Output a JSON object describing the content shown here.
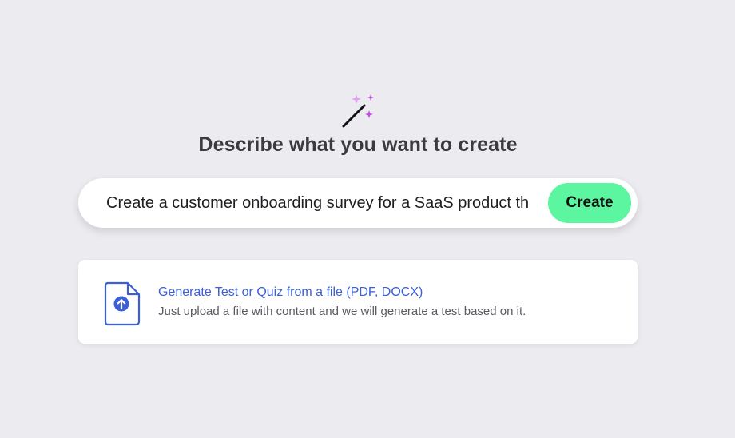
{
  "heading": "Describe what you want to create",
  "prompt": {
    "value": "Create a customer onboarding survey for a SaaS product th",
    "button_label": "Create"
  },
  "upload_card": {
    "title": "Generate Test or Quiz from a file (PDF, DOCX)",
    "description": "Just upload a file with content and we will generate a test based on it."
  },
  "icons": {
    "header": "magic-wand-icon",
    "upload": "file-upload-icon"
  },
  "colors": {
    "background": "#ebebf0",
    "accent_button": "#5cf5a0",
    "link_blue": "#3a5fd9",
    "sparkle_purple": "#c34ee0"
  }
}
